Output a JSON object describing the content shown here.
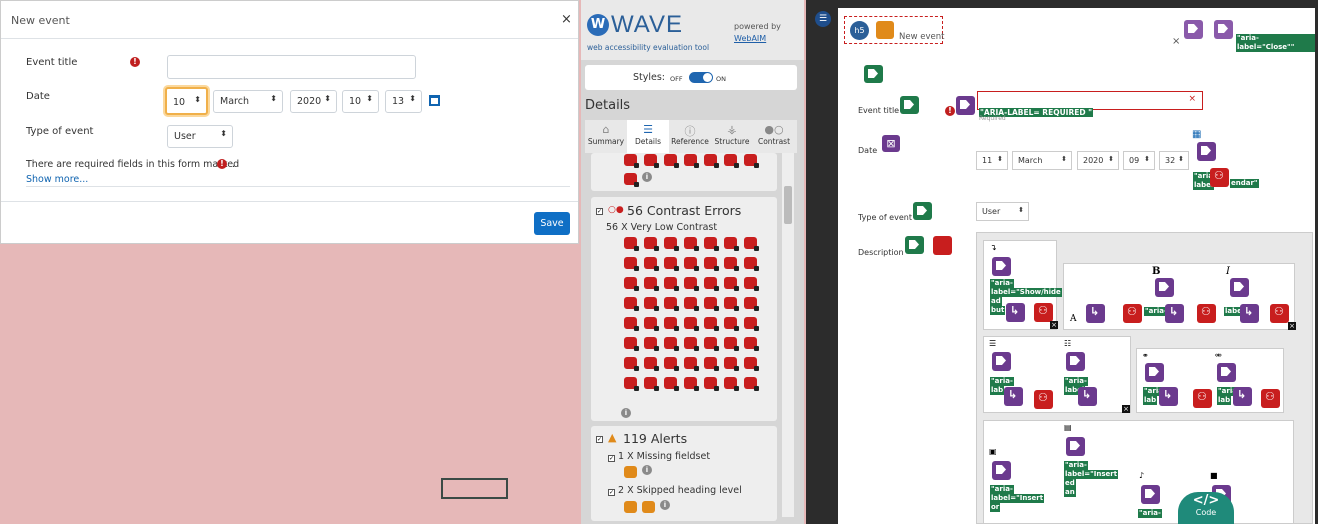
{
  "dialog": {
    "title": "New event",
    "close": "×",
    "fields": {
      "event_title_label": "Event title",
      "date_label": "Date",
      "type_label": "Type of event",
      "day": "10",
      "month": "March",
      "year": "2020",
      "hour": "10",
      "minute": "13",
      "type_value": "User"
    },
    "required_note": "There are required fields in this form marked",
    "required_note_end": ".",
    "show_more": "Show more...",
    "save": "Save",
    "required_mark": "!"
  },
  "wave": {
    "logo": "W",
    "name": "WAVE",
    "subtitle": "web accessibility evaluation tool",
    "powered_by": "powered by",
    "webaim": "WebAIM",
    "styles_label": "Styles:",
    "off": "OFF",
    "on": "ON",
    "details_heading": "Details",
    "tabs": [
      {
        "label": "Summary",
        "icon": "home-icon"
      },
      {
        "label": "Details",
        "icon": "list-icon"
      },
      {
        "label": "Reference",
        "icon": "info-icon"
      },
      {
        "label": "Structure",
        "icon": "sitemap-icon"
      },
      {
        "label": "Contrast",
        "icon": "contrast-icon"
      }
    ],
    "contrast": {
      "title": "56 Contrast Errors",
      "item": "56 X Very Low Contrast"
    },
    "alerts": {
      "title": "119 Alerts",
      "item1": "1 X Missing fieldset",
      "item2": "2 X Skipped heading level"
    },
    "info": "i"
  },
  "page": {
    "heading_badge": "h5",
    "new_event": "New event",
    "close_x": "×",
    "aria_close": "\"aria-label=\"Close\"\"",
    "event_title": "Event title",
    "date": "Date",
    "type_of_event": "Type of event",
    "description": "Description",
    "aria_required": "\"ARIA-LABEL= REQUIRED \"",
    "required": "Required",
    "day": "11",
    "month": "March",
    "year": "2020",
    "hour": "09",
    "minute": "32",
    "type_value": "User",
    "aria_texts": [
      "\"aria-",
      "label=\"Show/hide",
      "ad",
      "but",
      "\"aria-",
      "label",
      "\"aria-",
      "lab",
      "\"aria-",
      "label",
      "\"aria-",
      "lab",
      "\"aria-",
      "lab",
      "\"aria-",
      "label=\"Insert",
      "or",
      "\"aria-",
      "label=\"Insert",
      "ed",
      "an",
      "\"aria-"
    ],
    "cal_text_top": "\"aria-",
    "cal_text_mid": "label",
    "cal_text_end": "endar\"",
    "bold": "B",
    "italic": "I",
    "code": "Code"
  }
}
